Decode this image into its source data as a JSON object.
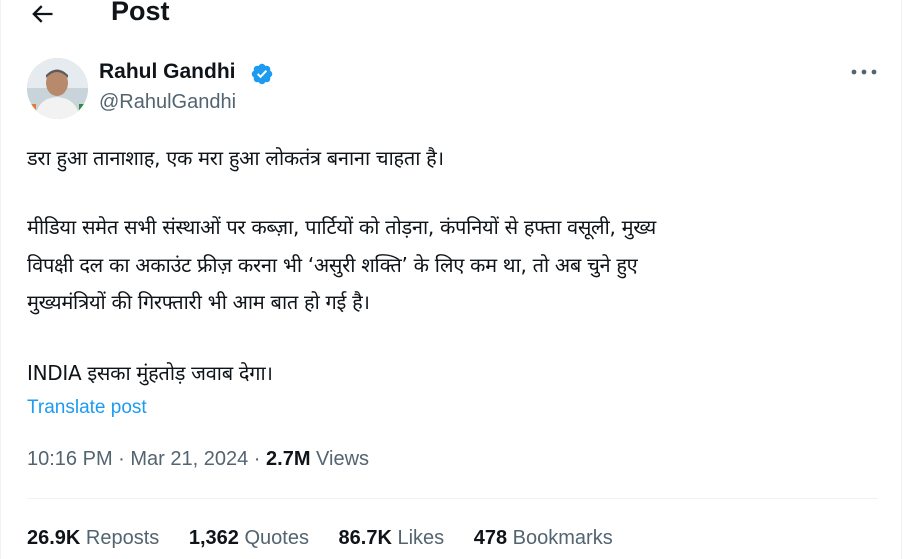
{
  "header": {
    "title": "Post",
    "back_icon": "arrow-left-icon"
  },
  "author": {
    "name": "Rahul Gandhi",
    "handle": "@RahulGandhi",
    "verified_icon": "verified-badge-icon",
    "verified_color": "#1d9bf0"
  },
  "more_icon": "more-horizontal-icon",
  "tweet": {
    "lines": [
      "डरा हुआ तानाशाह, एक मरा हुआ लोकतंत्र बनाना चाहता है।",
      "मीडिया समेत सभी संस्थाओं पर कब्ज़ा, पार्टियों को तोड़ना, कंपनियों से हफ्ता वसूली, मुख्य",
      "विपक्षी दल का अकाउंट फ्रीज़ करना भी ‘असुरी शक्ति’ के लिए कम था, तो अब चुने हुए",
      "मुख्यमंत्रियों की गिरफ्तारी भी आम बात हो गई है।",
      "INDIA इसका मुंहतोड़ जवाब देगा।"
    ]
  },
  "translate_label": "Translate post",
  "meta": {
    "time": "10:16 PM",
    "sep1": " · ",
    "date": "Mar 21, 2024",
    "sep2": " · ",
    "views_count": "2.7M",
    "views_label": " Views"
  },
  "stats": [
    {
      "count": "26.9K",
      "label": " Reposts"
    },
    {
      "count": "1,362",
      "label": " Quotes"
    },
    {
      "count": "86.7K",
      "label": " Likes"
    },
    {
      "count": "478",
      "label": " Bookmarks"
    }
  ],
  "colors": {
    "text": "#0f1419",
    "secondary": "#536471",
    "link": "#1d9bf0",
    "border": "#eff3f4"
  }
}
